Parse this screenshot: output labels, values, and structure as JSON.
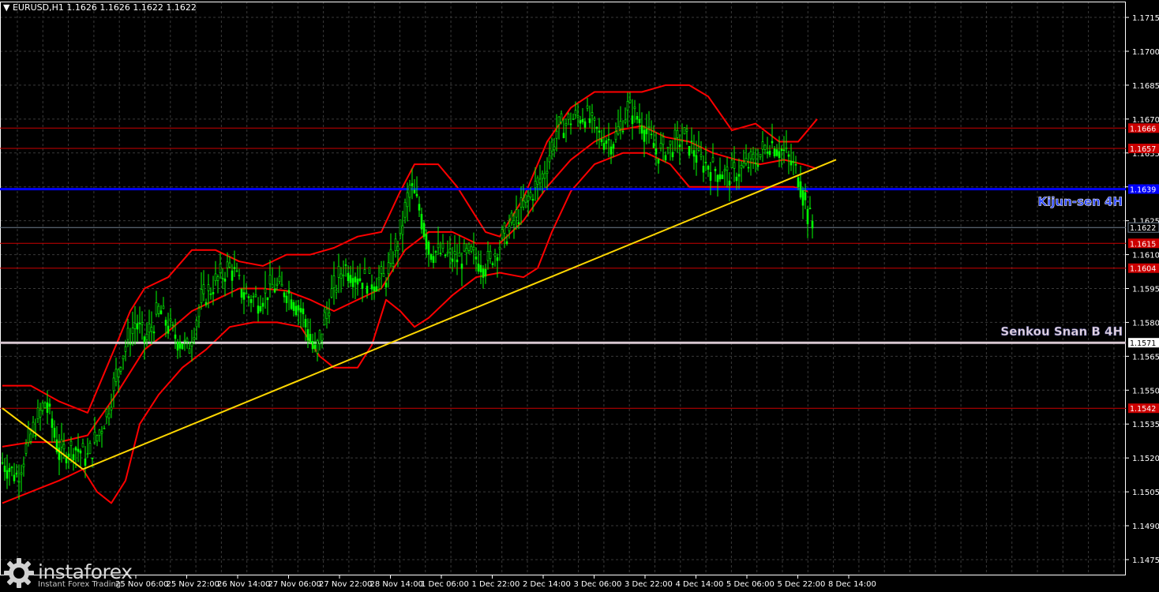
{
  "header": {
    "symbol": "EURUSD,H1",
    "ohlc": "1.1626 1.1626 1.1622 1.1622"
  },
  "logo": {
    "name": "instaforex",
    "tagline": "Instant Forex Trading",
    "icon": "gear-logo-icon"
  },
  "colors": {
    "background": "#000000",
    "grid": "#3a3a3a",
    "candle": "#00ff00",
    "bands": "#ff0000",
    "level": "#cc0000",
    "kijun": "#0000ff",
    "senkou": "#d9c8d2",
    "trend": "#ffd700",
    "axis": "#ffffff"
  },
  "chart_data": {
    "type": "line",
    "title": "",
    "grid": true,
    "ylim": [
      1.1468,
      1.1722
    ],
    "y_ticks": [
      "1.1715",
      "1.1700",
      "1.1685",
      "1.1670",
      "1.1655",
      "1.1640",
      "1.1625",
      "1.1610",
      "1.1595",
      "1.1580",
      "1.1565",
      "1.1550",
      "1.1535",
      "1.1520",
      "1.1505",
      "1.1490",
      "1.1475"
    ],
    "x_ticks": [
      "25 Nov 06:00",
      "25 Nov 22:00",
      "26 Nov 14:00",
      "27 Nov 06:00",
      "27 Nov 22:00",
      "28 Nov 14:00",
      "1 Dec 06:00",
      "1 Dec 22:00",
      "2 Dec 14:00",
      "3 Dec 06:00",
      "3 Dec 22:00",
      "4 Dec 14:00",
      "5 Dec 06:00",
      "5 Dec 22:00",
      "8 Dec 14:00"
    ],
    "price_series": [
      {
        "bar": 0,
        "close": 1.1518
      },
      {
        "bar": 6,
        "close": 1.1512
      },
      {
        "bar": 12,
        "close": 1.153
      },
      {
        "bar": 18,
        "close": 1.1545
      },
      {
        "bar": 24,
        "close": 1.1522
      },
      {
        "bar": 30,
        "close": 1.1525
      },
      {
        "bar": 36,
        "close": 1.152
      },
      {
        "bar": 44,
        "close": 1.154
      },
      {
        "bar": 50,
        "close": 1.1565
      },
      {
        "bar": 56,
        "close": 1.158
      },
      {
        "bar": 60,
        "close": 1.1572
      },
      {
        "bar": 66,
        "close": 1.1585
      },
      {
        "bar": 72,
        "close": 1.1575
      },
      {
        "bar": 78,
        "close": 1.1568
      },
      {
        "bar": 84,
        "close": 1.159
      },
      {
        "bar": 90,
        "close": 1.1598
      },
      {
        "bar": 96,
        "close": 1.1605
      },
      {
        "bar": 102,
        "close": 1.1592
      },
      {
        "bar": 108,
        "close": 1.159
      },
      {
        "bar": 114,
        "close": 1.1596
      },
      {
        "bar": 120,
        "close": 1.1594
      },
      {
        "bar": 126,
        "close": 1.1585
      },
      {
        "bar": 132,
        "close": 1.1565
      },
      {
        "bar": 138,
        "close": 1.159
      },
      {
        "bar": 144,
        "close": 1.1605
      },
      {
        "bar": 150,
        "close": 1.16
      },
      {
        "bar": 156,
        "close": 1.1598
      },
      {
        "bar": 162,
        "close": 1.16
      },
      {
        "bar": 168,
        "close": 1.162
      },
      {
        "bar": 172,
        "close": 1.164
      },
      {
        "bar": 176,
        "close": 1.163
      },
      {
        "bar": 180,
        "close": 1.1612
      },
      {
        "bar": 186,
        "close": 1.161
      },
      {
        "bar": 192,
        "close": 1.1608
      },
      {
        "bar": 198,
        "close": 1.161
      },
      {
        "bar": 204,
        "close": 1.1605
      },
      {
        "bar": 210,
        "close": 1.1615
      },
      {
        "bar": 216,
        "close": 1.1625
      },
      {
        "bar": 222,
        "close": 1.1635
      },
      {
        "bar": 228,
        "close": 1.1645
      },
      {
        "bar": 234,
        "close": 1.1665
      },
      {
        "bar": 240,
        "close": 1.167
      },
      {
        "bar": 246,
        "close": 1.1672
      },
      {
        "bar": 252,
        "close": 1.1662
      },
      {
        "bar": 258,
        "close": 1.166
      },
      {
        "bar": 264,
        "close": 1.1675
      },
      {
        "bar": 270,
        "close": 1.1668
      },
      {
        "bar": 276,
        "close": 1.1655
      },
      {
        "bar": 282,
        "close": 1.1658
      },
      {
        "bar": 288,
        "close": 1.1662
      },
      {
        "bar": 294,
        "close": 1.1652
      },
      {
        "bar": 300,
        "close": 1.1648
      },
      {
        "bar": 306,
        "close": 1.1645
      },
      {
        "bar": 312,
        "close": 1.1648
      },
      {
        "bar": 318,
        "close": 1.1652
      },
      {
        "bar": 324,
        "close": 1.166
      },
      {
        "bar": 330,
        "close": 1.1655
      },
      {
        "bar": 336,
        "close": 1.1645
      },
      {
        "bar": 340,
        "close": 1.1628
      },
      {
        "bar": 342,
        "close": 1.1622
      }
    ],
    "upper_band": [
      {
        "bar": 0,
        "value": 1.1552
      },
      {
        "bar": 12,
        "value": 1.1552
      },
      {
        "bar": 24,
        "value": 1.1545
      },
      {
        "bar": 36,
        "value": 1.154
      },
      {
        "bar": 48,
        "value": 1.157
      },
      {
        "bar": 54,
        "value": 1.1585
      },
      {
        "bar": 60,
        "value": 1.1595
      },
      {
        "bar": 70,
        "value": 1.16
      },
      {
        "bar": 80,
        "value": 1.1612
      },
      {
        "bar": 90,
        "value": 1.1612
      },
      {
        "bar": 100,
        "value": 1.1607
      },
      {
        "bar": 110,
        "value": 1.1605
      },
      {
        "bar": 120,
        "value": 1.161
      },
      {
        "bar": 130,
        "value": 1.161
      },
      {
        "bar": 140,
        "value": 1.1613
      },
      {
        "bar": 150,
        "value": 1.1618
      },
      {
        "bar": 160,
        "value": 1.162
      },
      {
        "bar": 168,
        "value": 1.1638
      },
      {
        "bar": 174,
        "value": 1.165
      },
      {
        "bar": 184,
        "value": 1.165
      },
      {
        "bar": 192,
        "value": 1.164
      },
      {
        "bar": 198,
        "value": 1.163
      },
      {
        "bar": 204,
        "value": 1.162
      },
      {
        "bar": 210,
        "value": 1.1618
      },
      {
        "bar": 220,
        "value": 1.1635
      },
      {
        "bar": 230,
        "value": 1.166
      },
      {
        "bar": 240,
        "value": 1.1675
      },
      {
        "bar": 250,
        "value": 1.1682
      },
      {
        "bar": 260,
        "value": 1.1682
      },
      {
        "bar": 270,
        "value": 1.1682
      },
      {
        "bar": 280,
        "value": 1.1685
      },
      {
        "bar": 290,
        "value": 1.1685
      },
      {
        "bar": 298,
        "value": 1.168
      },
      {
        "bar": 308,
        "value": 1.1665
      },
      {
        "bar": 318,
        "value": 1.1668
      },
      {
        "bar": 328,
        "value": 1.166
      },
      {
        "bar": 336,
        "value": 1.166
      },
      {
        "bar": 344,
        "value": 1.167
      }
    ],
    "middle_band": [
      {
        "bar": 0,
        "value": 1.1525
      },
      {
        "bar": 12,
        "value": 1.1527
      },
      {
        "bar": 24,
        "value": 1.1527
      },
      {
        "bar": 36,
        "value": 1.153
      },
      {
        "bar": 48,
        "value": 1.1548
      },
      {
        "bar": 60,
        "value": 1.1568
      },
      {
        "bar": 70,
        "value": 1.1576
      },
      {
        "bar": 80,
        "value": 1.1585
      },
      {
        "bar": 90,
        "value": 1.159
      },
      {
        "bar": 100,
        "value": 1.1595
      },
      {
        "bar": 110,
        "value": 1.1595
      },
      {
        "bar": 120,
        "value": 1.1594
      },
      {
        "bar": 130,
        "value": 1.159
      },
      {
        "bar": 140,
        "value": 1.1585
      },
      {
        "bar": 150,
        "value": 1.159
      },
      {
        "bar": 160,
        "value": 1.1595
      },
      {
        "bar": 170,
        "value": 1.1612
      },
      {
        "bar": 180,
        "value": 1.162
      },
      {
        "bar": 190,
        "value": 1.162
      },
      {
        "bar": 200,
        "value": 1.1615
      },
      {
        "bar": 210,
        "value": 1.1615
      },
      {
        "bar": 220,
        "value": 1.1625
      },
      {
        "bar": 230,
        "value": 1.164
      },
      {
        "bar": 240,
        "value": 1.1652
      },
      {
        "bar": 250,
        "value": 1.166
      },
      {
        "bar": 260,
        "value": 1.1665
      },
      {
        "bar": 270,
        "value": 1.1667
      },
      {
        "bar": 280,
        "value": 1.1662
      },
      {
        "bar": 290,
        "value": 1.166
      },
      {
        "bar": 300,
        "value": 1.1655
      },
      {
        "bar": 310,
        "value": 1.1652
      },
      {
        "bar": 320,
        "value": 1.165
      },
      {
        "bar": 330,
        "value": 1.1652
      },
      {
        "bar": 338,
        "value": 1.165
      },
      {
        "bar": 344,
        "value": 1.1648
      }
    ],
    "lower_band": [
      {
        "bar": 0,
        "value": 1.15
      },
      {
        "bar": 12,
        "value": 1.1505
      },
      {
        "bar": 24,
        "value": 1.151
      },
      {
        "bar": 34,
        "value": 1.1515
      },
      {
        "bar": 40,
        "value": 1.1505
      },
      {
        "bar": 46,
        "value": 1.15
      },
      {
        "bar": 52,
        "value": 1.151
      },
      {
        "bar": 58,
        "value": 1.1535
      },
      {
        "bar": 66,
        "value": 1.1548
      },
      {
        "bar": 76,
        "value": 1.156
      },
      {
        "bar": 86,
        "value": 1.1568
      },
      {
        "bar": 96,
        "value": 1.1578
      },
      {
        "bar": 106,
        "value": 1.158
      },
      {
        "bar": 116,
        "value": 1.158
      },
      {
        "bar": 126,
        "value": 1.1578
      },
      {
        "bar": 134,
        "value": 1.1565
      },
      {
        "bar": 140,
        "value": 1.156
      },
      {
        "bar": 150,
        "value": 1.156
      },
      {
        "bar": 156,
        "value": 1.157
      },
      {
        "bar": 162,
        "value": 1.159
      },
      {
        "bar": 168,
        "value": 1.1585
      },
      {
        "bar": 174,
        "value": 1.1578
      },
      {
        "bar": 180,
        "value": 1.1582
      },
      {
        "bar": 190,
        "value": 1.1592
      },
      {
        "bar": 200,
        "value": 1.16
      },
      {
        "bar": 210,
        "value": 1.1602
      },
      {
        "bar": 220,
        "value": 1.16
      },
      {
        "bar": 226,
        "value": 1.1604
      },
      {
        "bar": 232,
        "value": 1.162
      },
      {
        "bar": 240,
        "value": 1.1638
      },
      {
        "bar": 250,
        "value": 1.165
      },
      {
        "bar": 262,
        "value": 1.1655
      },
      {
        "bar": 272,
        "value": 1.1655
      },
      {
        "bar": 282,
        "value": 1.165
      },
      {
        "bar": 290,
        "value": 1.164
      },
      {
        "bar": 300,
        "value": 1.164
      },
      {
        "bar": 312,
        "value": 1.164
      },
      {
        "bar": 324,
        "value": 1.164
      },
      {
        "bar": 334,
        "value": 1.164
      },
      {
        "bar": 340,
        "value": 1.1638
      }
    ],
    "trend_lines": [
      {
        "from": {
          "bar": 0,
          "price": 1.1542
        },
        "to": {
          "bar": 34,
          "price": 1.1515
        }
      },
      {
        "from": {
          "bar": 34,
          "price": 1.1515
        },
        "to": {
          "bar": 352,
          "price": 1.1652
        }
      }
    ],
    "levels": [
      {
        "price": 1.1666,
        "label": "1.1666",
        "color": "#cc0000",
        "style": "thin"
      },
      {
        "price": 1.1657,
        "label": "1.1657",
        "color": "#cc0000",
        "style": "thin"
      },
      {
        "price": 1.1639,
        "label": "1.1639",
        "color": "#0000ff",
        "style": "thick",
        "name": "Kijun-sen 4H"
      },
      {
        "price": 1.1622,
        "label": "1.1622",
        "color": "#708090",
        "style": "thin"
      },
      {
        "price": 1.1615,
        "label": "1.1615",
        "color": "#cc0000",
        "style": "thin"
      },
      {
        "price": 1.1604,
        "label": "1.1604",
        "color": "#cc0000",
        "style": "thin"
      },
      {
        "price": 1.1571,
        "label": "1.1571",
        "color": "#d9c8d2",
        "style": "thick",
        "name": "Senkou Snan B 4H"
      },
      {
        "price": 1.1542,
        "label": "1.1542",
        "color": "#cc0000",
        "style": "thin"
      }
    ]
  }
}
